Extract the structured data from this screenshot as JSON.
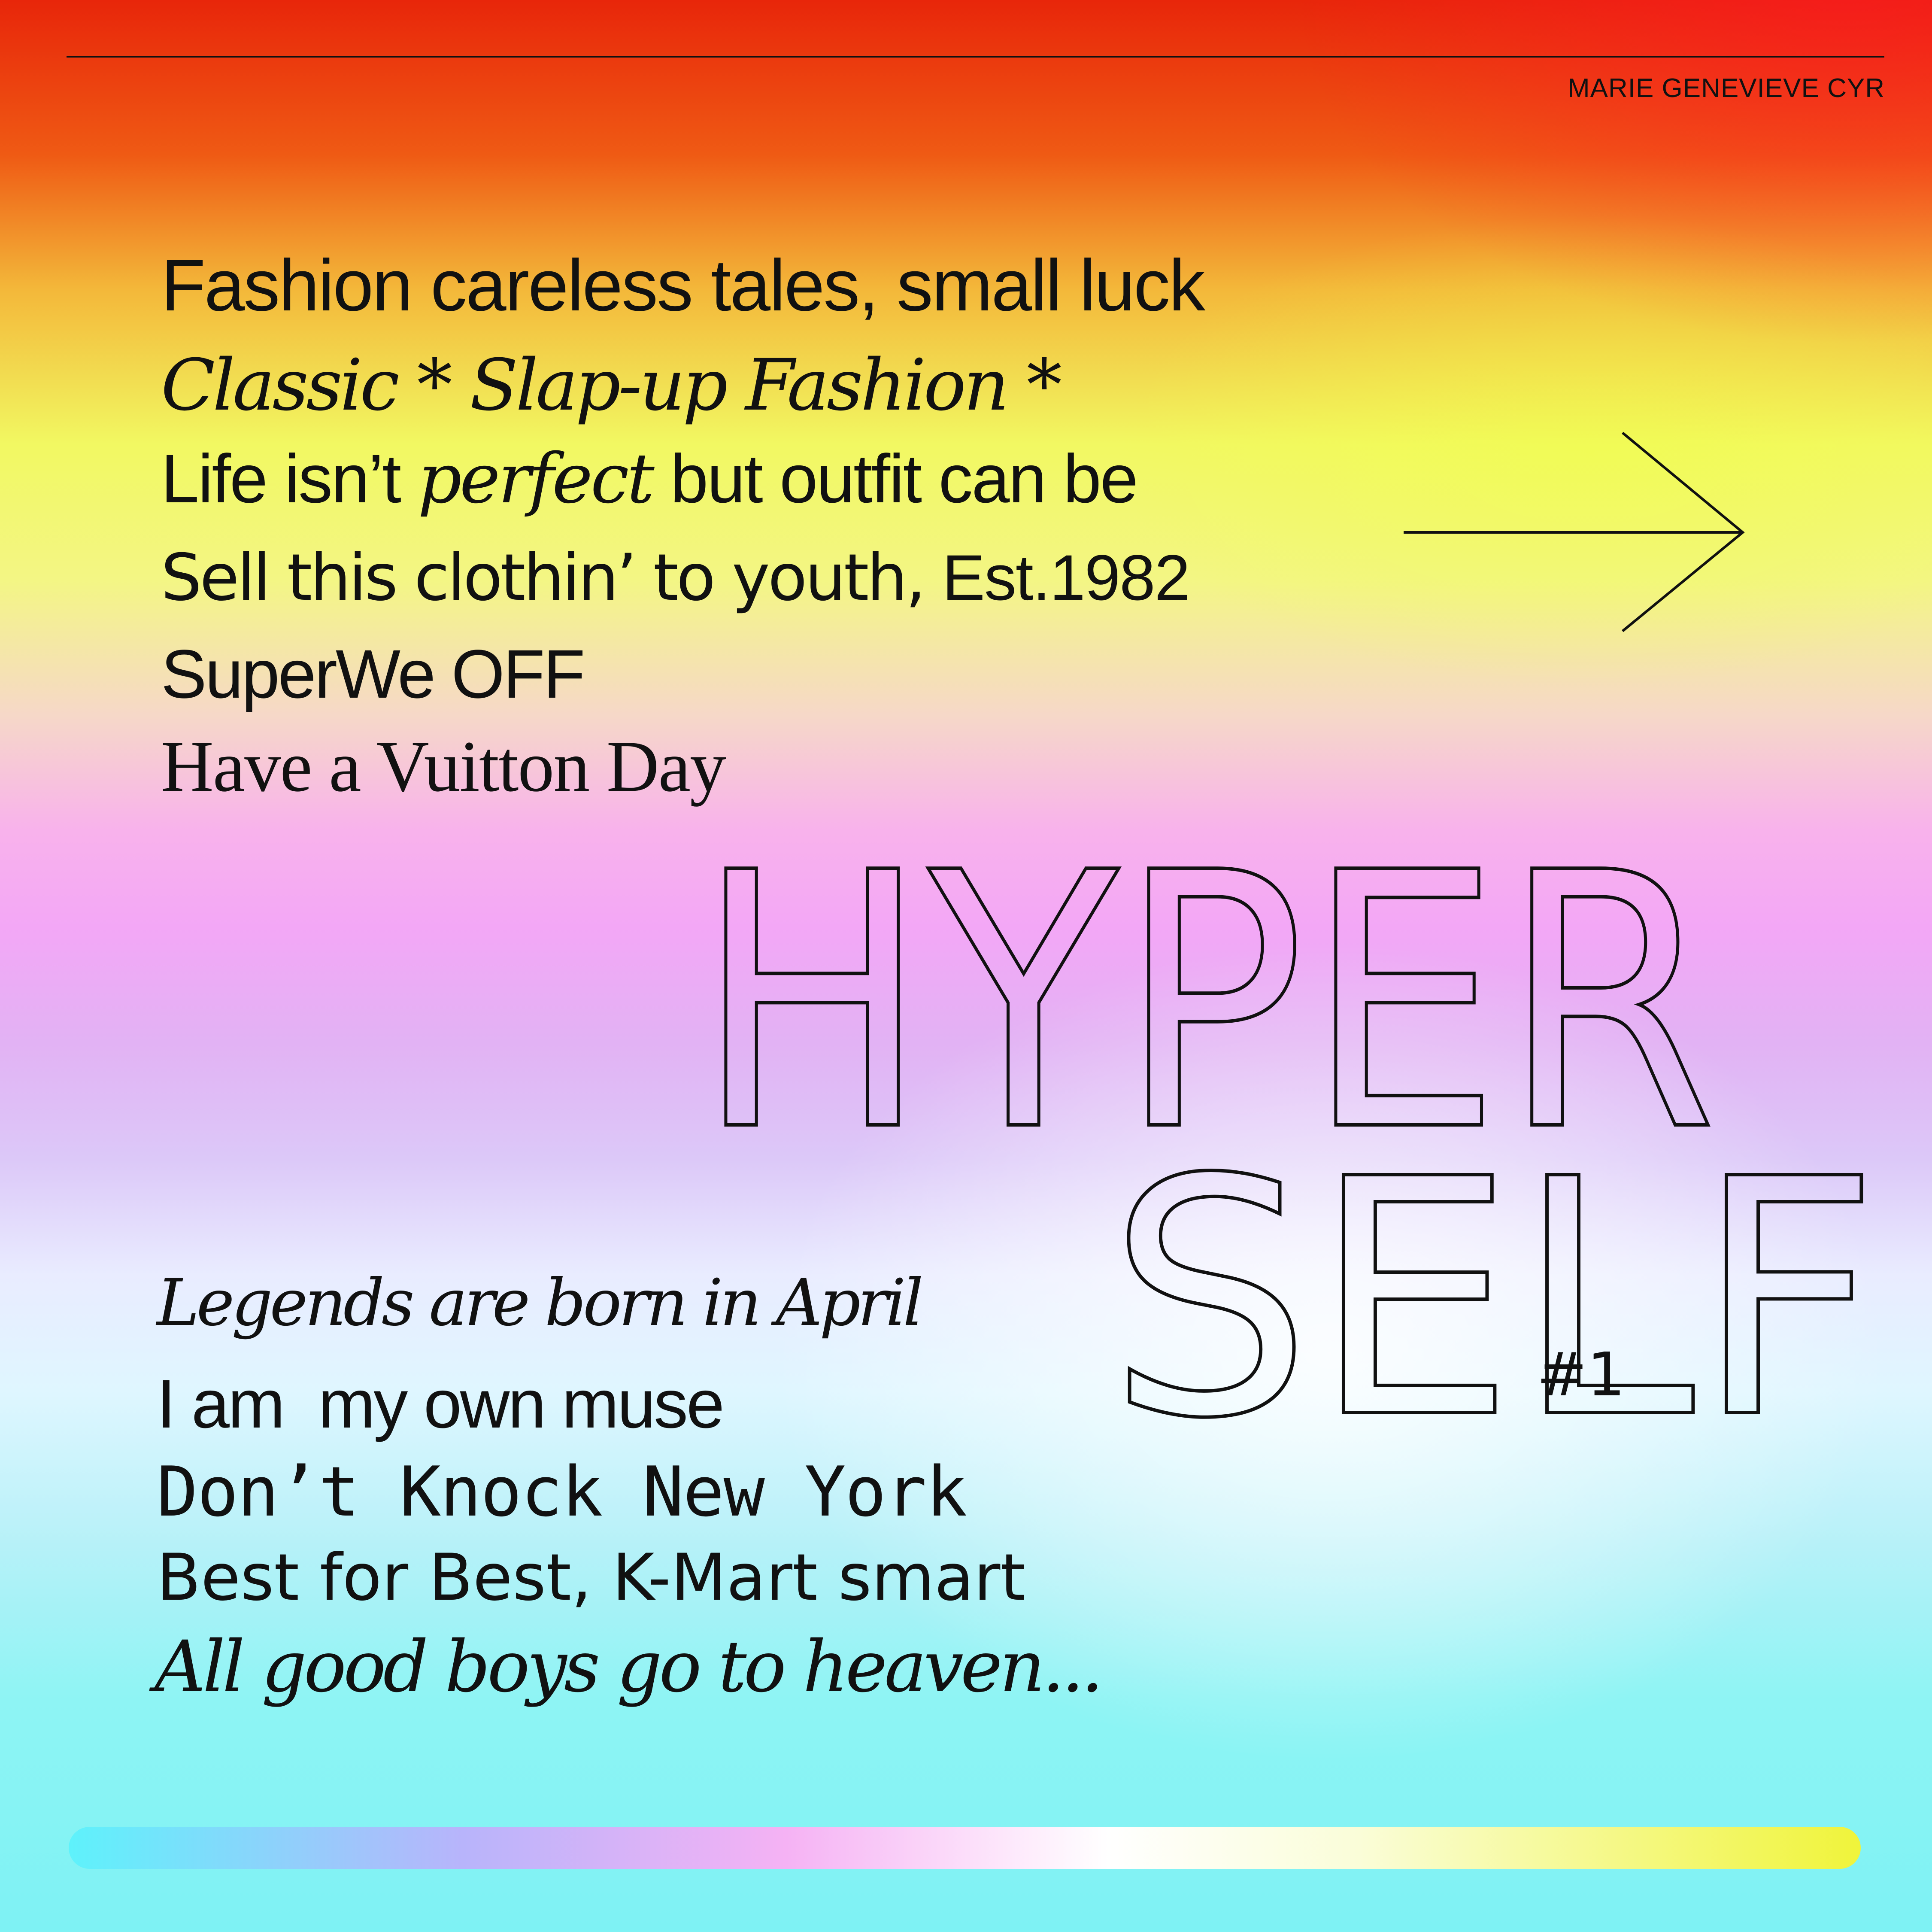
{
  "author": "MARIE GENEVIEVE CYR",
  "top_lines": {
    "line1": "Fashion careless tales, small luck",
    "line2": "Classic * Slap-up Fashion *",
    "line3_start": "Life isn’t ",
    "line3_italic": "perfect",
    "line3_end": " but outfit can be",
    "line4_start": "Sell this clothin’ to youth, ",
    "line4_end": "Est.1982",
    "line5": "SuperWe OFF",
    "line6": "Have a Vuitton Day"
  },
  "title": {
    "word1": "HYPER",
    "word2": "SELF",
    "number": "#1"
  },
  "bottom_lines": {
    "line7": "Legends are born in April",
    "line8": "I am  my own muse",
    "line9": "Don’t Knock New York",
    "line10": "Best for Best, K-Mart smart",
    "line11": "All good boys go to heaven..."
  },
  "arrow_icon": "arrow-right-icon",
  "colors": {
    "text": "#111111",
    "top": "#e8260a",
    "middle": "#f3a7f6",
    "bottom": "#7ef2f4"
  }
}
